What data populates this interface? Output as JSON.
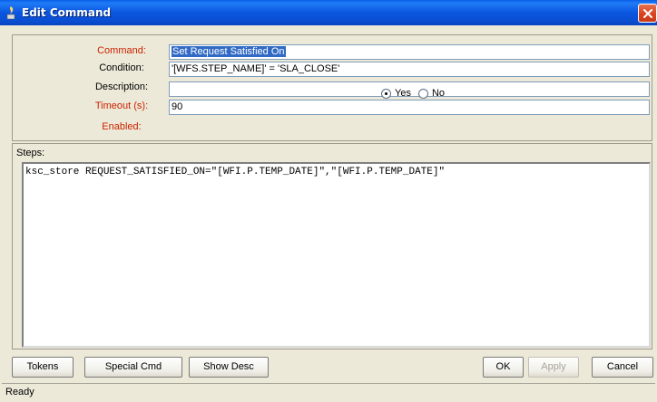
{
  "window": {
    "title": "Edit Command",
    "close_icon": "close-icon"
  },
  "form": {
    "command_label": "Command:",
    "command_value": "Set Request Satisfied On",
    "condition_label": "Condition:",
    "condition_value": "'[WFS.STEP_NAME]' = 'SLA_CLOSE'",
    "description_label": "Description:",
    "description_value": "",
    "timeout_label": "Timeout (s):",
    "timeout_value": "90",
    "enabled_label": "Enabled:",
    "enabled_options": [
      "Yes",
      "No"
    ],
    "enabled_selected": "Yes"
  },
  "steps": {
    "label": "Steps:",
    "content": "ksc_store REQUEST_SATISFIED_ON=\"[WFI.P.TEMP_DATE]\",\"[WFI.P.TEMP_DATE]\""
  },
  "buttons": {
    "tokens": "Tokens",
    "special_cmd": "Special Cmd",
    "show_desc": "Show Desc",
    "ok": "OK",
    "apply": "Apply",
    "cancel": "Cancel"
  },
  "status": {
    "text": "Ready"
  },
  "colors": {
    "required_label": "#cc2200",
    "title_bar": "#0a5fe6",
    "selection": "#316ac5"
  }
}
